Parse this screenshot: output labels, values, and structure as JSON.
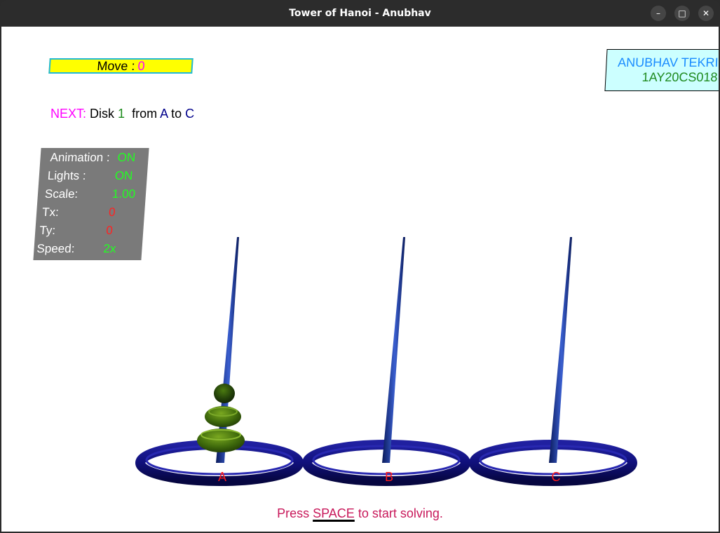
{
  "window": {
    "title": "Tower of Hanoi - Anubhav",
    "minimize_icon": "minimize-icon",
    "maximize_icon": "maximize-icon",
    "close_icon": "close-icon"
  },
  "move": {
    "label": "Move :",
    "value": "0"
  },
  "author": {
    "name": "ANUBHAV TEKRI",
    "id": "1AY20CS018"
  },
  "next": {
    "label": "NEXT:",
    "disk_word": "Disk",
    "disk": "1",
    "from_word": "from",
    "source": "A",
    "to_word": "to",
    "target": "C"
  },
  "status": {
    "animation": {
      "label": "Animation :",
      "value": "ON"
    },
    "lights": {
      "label": "Lights :",
      "value": "ON"
    },
    "scale": {
      "label": "Scale:",
      "value": "1.00"
    },
    "tx": {
      "label": "Tx:",
      "value": "0"
    },
    "ty": {
      "label": "Ty:",
      "value": "0"
    },
    "speed": {
      "label": "Speed:",
      "value": "2x"
    }
  },
  "pegs": [
    {
      "label": "A",
      "disks": 3
    },
    {
      "label": "B",
      "disks": 0
    },
    {
      "label": "C",
      "disks": 0
    }
  ],
  "hint": {
    "before": "Press ",
    "key": "SPACE",
    "after": " to start solving."
  },
  "colors": {
    "ring": "#10107a",
    "peg": "#1f3fa0",
    "disk": "#4a7a10",
    "peg_label": "#ff1a1a",
    "move_box": "#ffff00",
    "author_box": "#ccffff",
    "status_panel": "#7a7a7a"
  }
}
